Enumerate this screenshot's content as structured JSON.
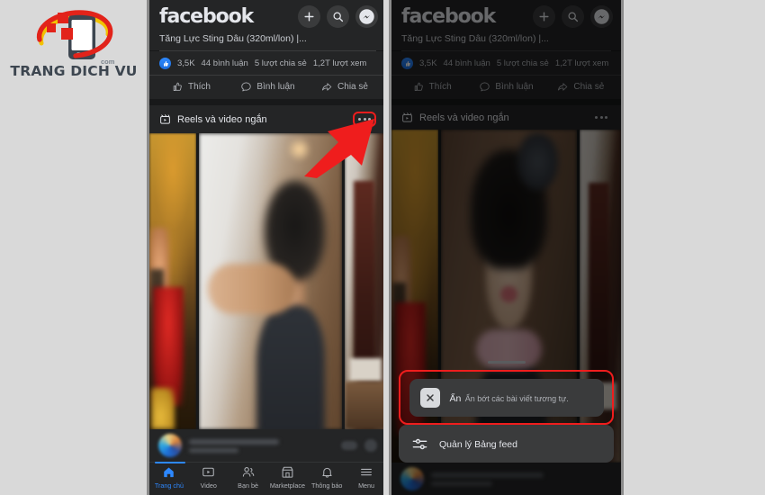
{
  "branding": {
    "name": "TRANG DICH VU",
    "suffix": "com",
    "icon": "phone-logo-icon"
  },
  "colors": {
    "accent_red": "#ef1d1d",
    "fb_blue": "#2d88ff",
    "surface": "#242526",
    "background": "#18191a",
    "menu_surface": "#3a3b3c",
    "text_primary": "#e4e6eb",
    "text_secondary": "#b0b3b8",
    "page_background": "#d9d9d9"
  },
  "app": {
    "brand": "facebook",
    "top_actions": [
      {
        "name": "create-button",
        "icon": "plus-icon"
      },
      {
        "name": "search-button",
        "icon": "search-icon"
      },
      {
        "name": "messenger-button",
        "icon": "messenger-icon"
      }
    ],
    "post": {
      "title": "Tăng Lực Sting Dâu (320ml/lon) |...",
      "stats": {
        "reactions": "3,5K",
        "comments": "44 bình luận",
        "shares": "5 lượt chia sẻ",
        "views": "1,2T lượt xem"
      },
      "actions": [
        {
          "label": "Thích",
          "icon": "thumbs-up-icon"
        },
        {
          "label": "Bình luận",
          "icon": "comment-icon"
        },
        {
          "label": "Chia sẻ",
          "icon": "share-icon"
        }
      ]
    },
    "reels_section": {
      "label": "Reels và video ngắn",
      "icon": "reels-icon",
      "overflow_label": "..."
    },
    "nav": [
      {
        "label": "Trang chủ",
        "icon": "home-icon",
        "active": true
      },
      {
        "label": "Video",
        "icon": "video-icon",
        "active": false
      },
      {
        "label": "Bạn bè",
        "icon": "friends-icon",
        "active": false
      },
      {
        "label": "Marketplace",
        "icon": "marketplace-icon",
        "active": false
      },
      {
        "label": "Thông báo",
        "icon": "bell-icon",
        "active": false
      },
      {
        "label": "Menu",
        "icon": "hamburger-icon",
        "active": false
      }
    ],
    "context_menu": {
      "items": [
        {
          "title": "Ẩn",
          "subtitle": "Ẩn bớt các bài viết tương tự.",
          "icon": "x-close-icon",
          "highlighted": true
        },
        {
          "title": "Quản lý Bảng feed",
          "subtitle": "",
          "icon": "sliders-icon",
          "highlighted": false
        }
      ]
    }
  },
  "annotations": {
    "arrow": {
      "name": "red-pointer-arrow",
      "direction": "up-right"
    },
    "highlight_overflow": {
      "name": "overflow-highlight-box"
    },
    "highlight_menu_item": {
      "name": "hide-item-highlight-box"
    }
  }
}
